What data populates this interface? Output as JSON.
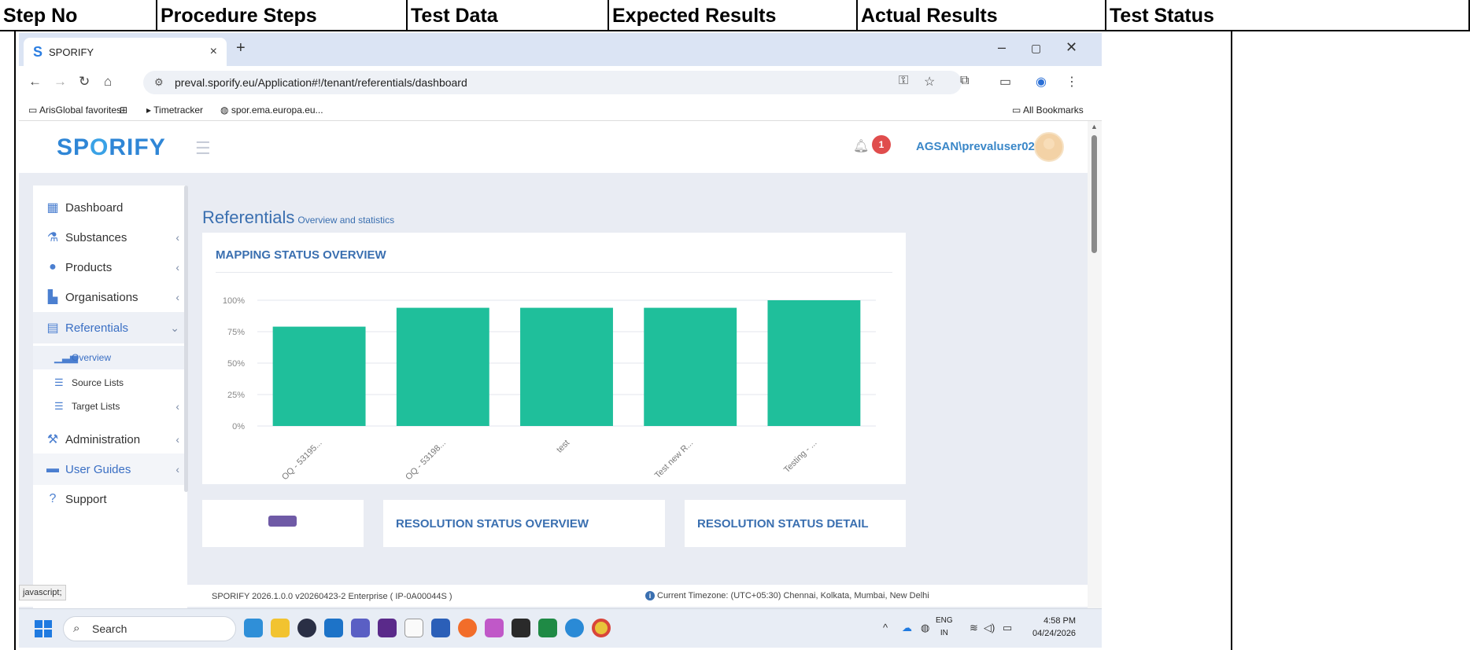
{
  "doc_table": {
    "headers": [
      "Step No",
      "Procedure Steps",
      "Test Data",
      "Expected Results",
      "Actual Results",
      "Test Status"
    ]
  },
  "browser": {
    "tab_title": "SPORIFY",
    "tab_close": "×",
    "new_tab": "+",
    "window_controls": [
      "–",
      "▢",
      "✕"
    ],
    "url": "preval.sporify.eu/Application#!/tenant/referentials/dashboard",
    "bookmarks": [
      "ArisGlobal favorites",
      "Timetracker",
      "spor.ema.europa.eu..."
    ],
    "all_bookmarks": "All Bookmarks"
  },
  "app": {
    "brand_left": "SP",
    "brand_o": "O",
    "brand_right": "RIFY",
    "notification_count": "1",
    "user": "AGSAN\\prevaluser02",
    "sidebar": {
      "items": [
        {
          "label": "Dashboard",
          "icon": "dashboard-icon"
        },
        {
          "label": "Substances",
          "icon": "flask-icon"
        },
        {
          "label": "Products",
          "icon": "pills-icon"
        },
        {
          "label": "Organisations",
          "icon": "factory-icon"
        },
        {
          "label": "Referentials",
          "icon": "list-box-icon"
        },
        {
          "label": "Administration",
          "icon": "wrench-icon"
        },
        {
          "label": "User Guides",
          "icon": "book-icon"
        },
        {
          "label": "Support",
          "icon": "question-icon"
        }
      ],
      "sub_items": [
        {
          "label": "Overview",
          "icon": "bar-chart-icon"
        },
        {
          "label": "Source Lists",
          "icon": "list-icon"
        },
        {
          "label": "Target Lists",
          "icon": "list-icon"
        }
      ]
    },
    "page_title": "Referentials",
    "page_subtitle": "Overview and statistics",
    "card_title": "MAPPING STATUS OVERVIEW",
    "card2_title": "RESOLUTION STATUS OVERVIEW",
    "card3_title": "RESOLUTION STATUS DETAIL",
    "footer_version": "SPORIFY 2026.1.0.0 v20260423-2 Enterprise ( IP-0A00044S )",
    "footer_timezone": "Current Timezone: (UTC+05:30) Chennai, Kolkata, Mumbai, New Delhi",
    "status_bubble": "javascript;"
  },
  "chart_data": {
    "type": "bar",
    "title": "MAPPING STATUS OVERVIEW",
    "categories": [
      "OQ - 53195...",
      "OQ - 53198...",
      "test",
      "Test new R...",
      "Testing - ..."
    ],
    "values": [
      79,
      94,
      94,
      94,
      100
    ],
    "y_ticks": [
      "0%",
      "25%",
      "50%",
      "75%",
      "100%"
    ],
    "ylim": [
      0,
      100
    ],
    "color": "#1fbf9b",
    "grid": true
  },
  "taskbar": {
    "search_label": "Search",
    "lang_top": "ENG",
    "lang_bottom": "IN",
    "time": "4:58 PM",
    "date": "04/24/2026"
  }
}
